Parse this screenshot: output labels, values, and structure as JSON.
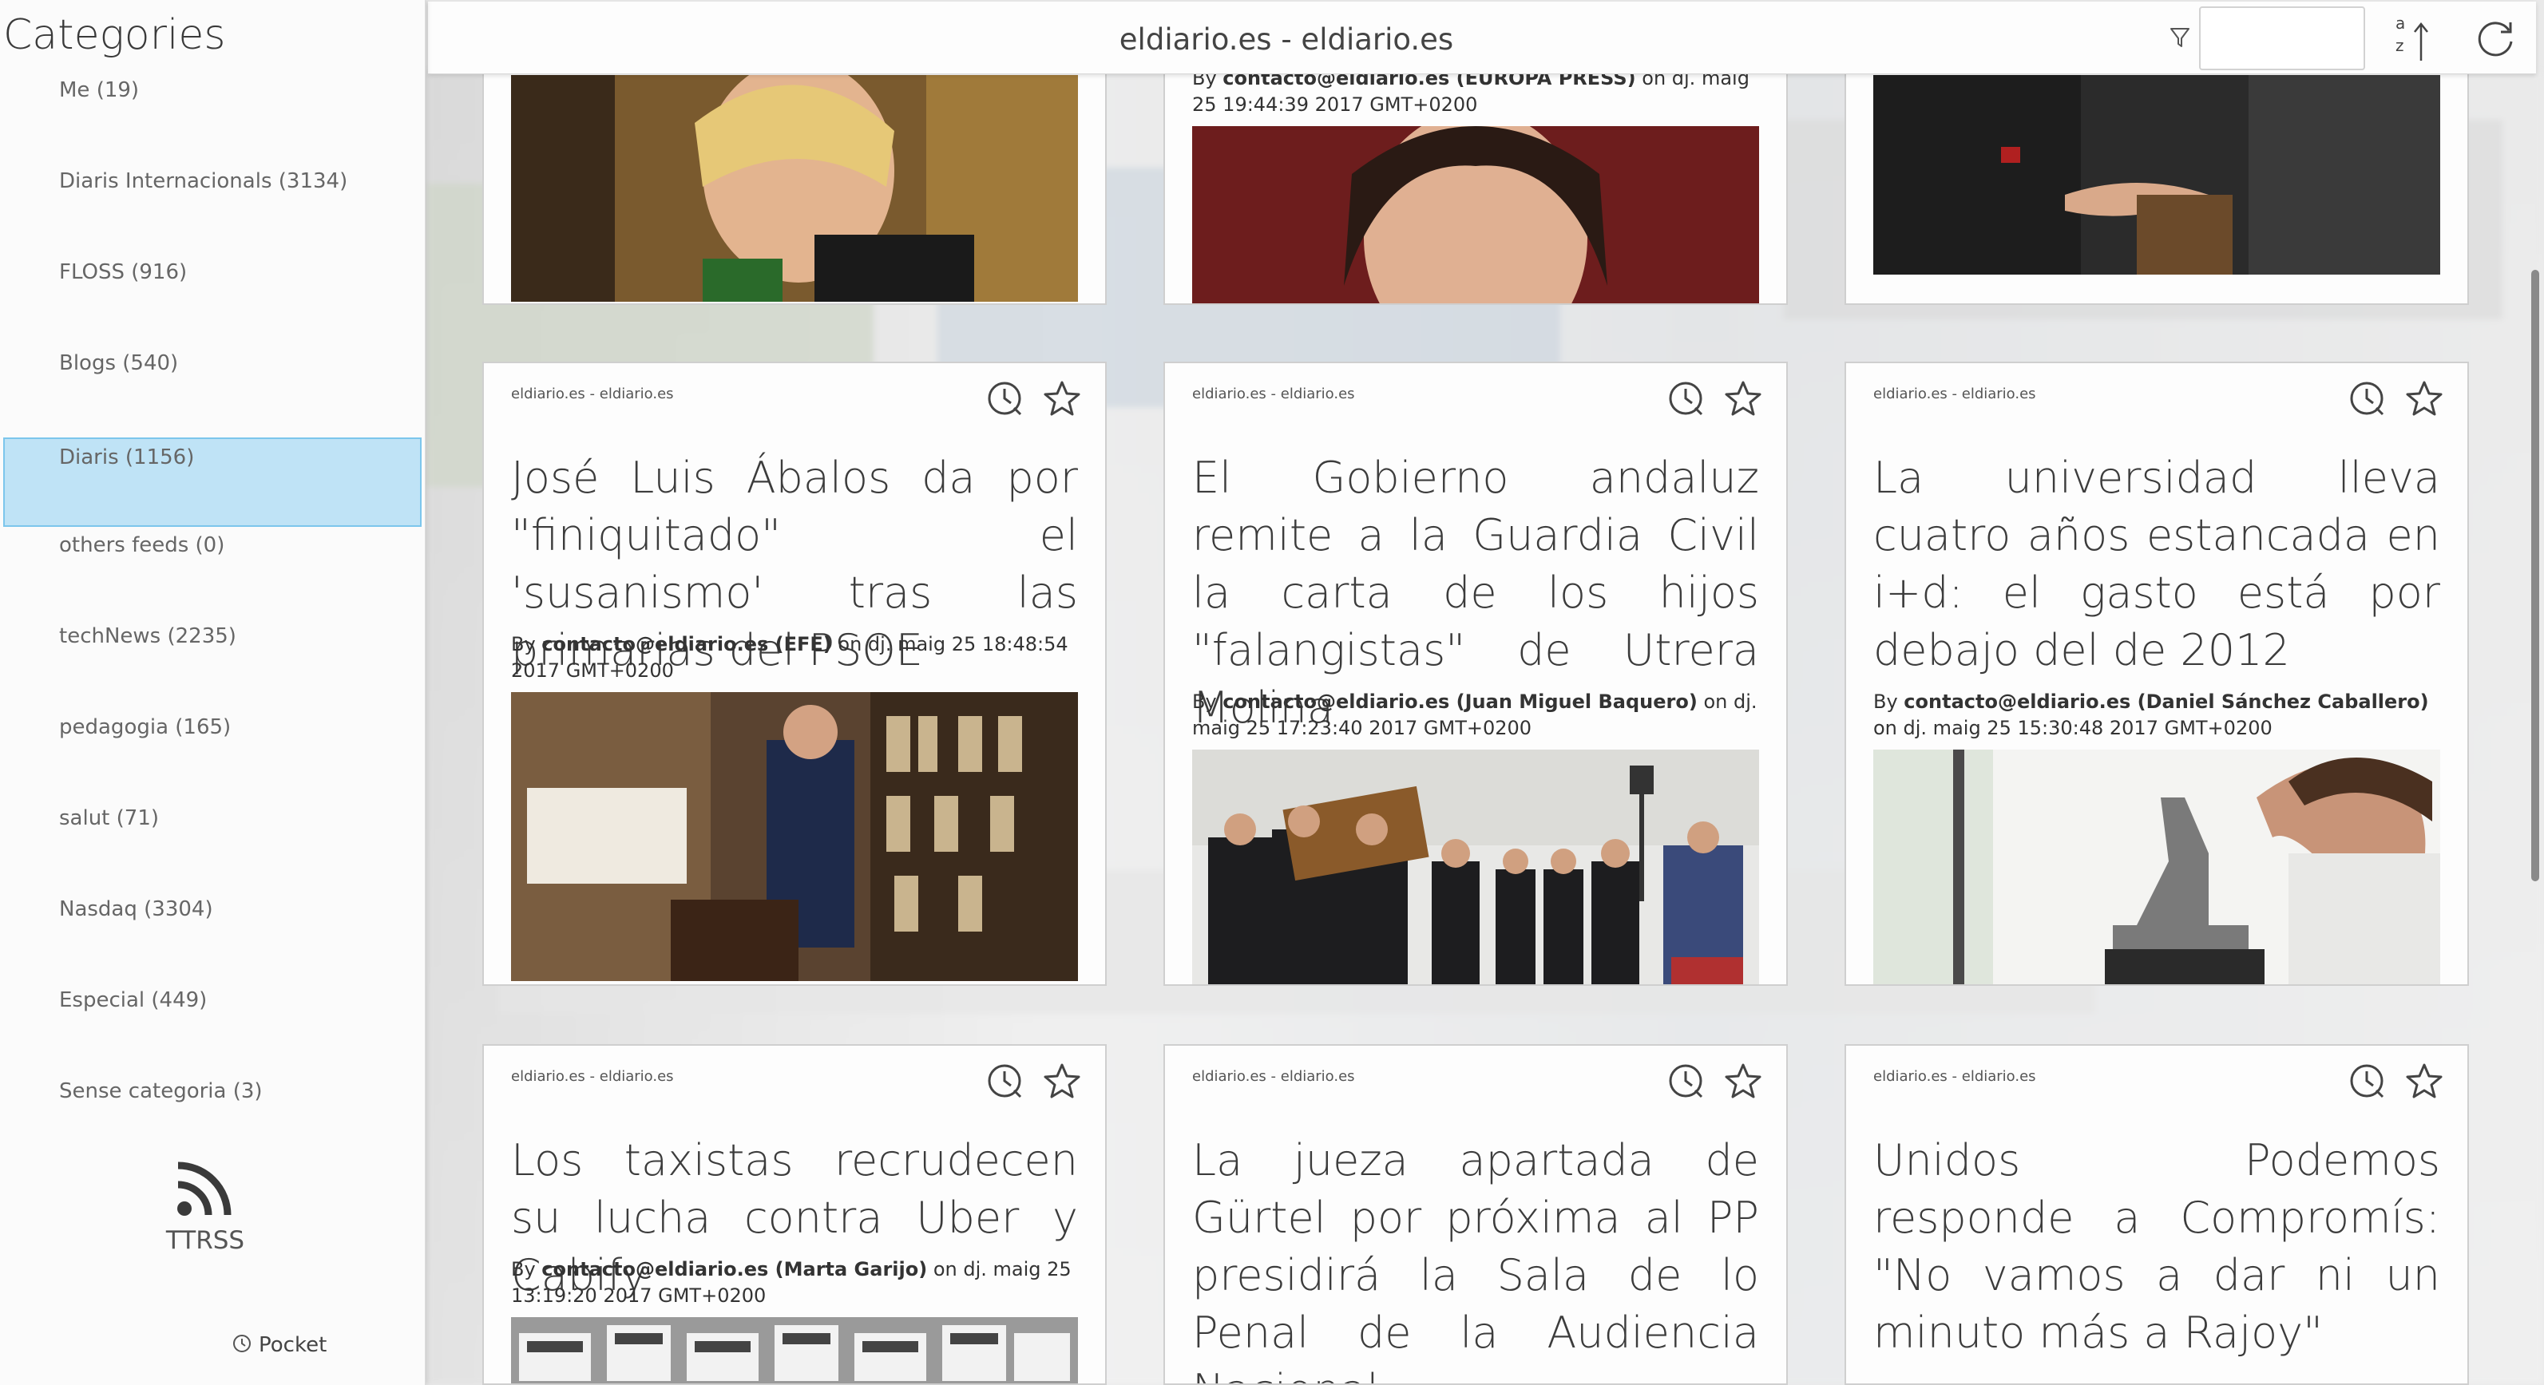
{
  "sidebar": {
    "title": "Categories",
    "items": [
      {
        "label": "Me (19)"
      },
      {
        "label": "Diaris Internacionals (3134)"
      },
      {
        "label": "FLOSS (916)"
      },
      {
        "label": "Blogs (540)"
      },
      {
        "label": "Diaris (1156)",
        "selected": true
      },
      {
        "label": "others feeds (0)"
      },
      {
        "label": "techNews (2235)"
      },
      {
        "label": "pedagogia (165)"
      },
      {
        "label": "salut (71)"
      },
      {
        "label": "Nasdaq (3304)"
      },
      {
        "label": "Especial (449)"
      },
      {
        "label": "Sense categoria (3)"
      }
    ],
    "ttrss_label": "TTRSS",
    "pocket_label": "Pocket"
  },
  "topbar": {
    "title": "eldiario.es - eldiario.es",
    "search_placeholder": ""
  },
  "top_partial": {
    "middle_meta_by": "By ",
    "middle_meta_author": "contacto@eldiario.es (EUROPA PRESS)",
    "middle_meta_date": " on dj. maig 25 19:44:39 2017 GMT+0200"
  },
  "articles": [
    {
      "feed": "eldiario.es - eldiario.es",
      "title": "José Luis Ábalos da por \"finiquitado\" el 'susanismo' tras las primarias del PSOE",
      "by": "By ",
      "author": "contacto@eldiario.es (EFE)",
      "date": " on dj. maig 25 18:48:54 2017 GMT+0200"
    },
    {
      "feed": "eldiario.es - eldiario.es",
      "title": "El Gobierno andaluz remite a la Guardia Civil la carta de los hijos \"falangistas\" de Utrera Molina",
      "by": "By ",
      "author": "contacto@eldiario.es (Juan Miguel Baquero)",
      "date": " on dj. maig 25 17:23:40 2017 GMT+0200"
    },
    {
      "feed": "eldiario.es - eldiario.es",
      "title": "La universidad lleva cuatro años estancada en i+d: el gasto está por debajo del de 2012",
      "by": "By ",
      "author": "contacto@eldiario.es (Daniel Sánchez Caballero)",
      "date": " on dj. maig 25 15:30:48 2017 GMT+0200"
    },
    {
      "feed": "eldiario.es - eldiario.es",
      "title": "Los taxistas recrudecen su lucha contra Uber y Cabify",
      "by": "By ",
      "author": "contacto@eldiario.es (Marta Garijo)",
      "date": " on dj. maig 25 13:19:20 2017 GMT+0200"
    },
    {
      "feed": "eldiario.es - eldiario.es",
      "title": "La jueza apartada de Gürtel por próxima al PP presidirá la Sala de lo Penal de la Audiencia Nacional"
    },
    {
      "feed": "eldiario.es - eldiario.es",
      "title": "Unidos Podemos responde a Compromís: \"No vamos a dar ni un minuto más a Rajoy\""
    }
  ],
  "icons": {
    "rss": "rss-icon",
    "pocket": "pocket-icon",
    "filter": "filter-icon",
    "sort": "sort-az-icon",
    "refresh": "refresh-icon",
    "read_later": "clock-icon",
    "star": "star-icon"
  },
  "colors": {
    "selected_bg": "#bfe3f6",
    "selected_border": "#7cc6ec"
  }
}
